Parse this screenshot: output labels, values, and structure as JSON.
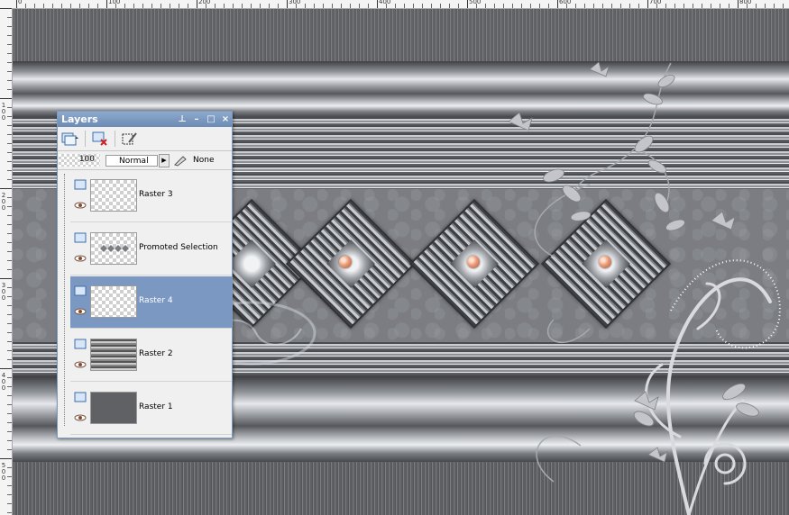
{
  "ruler": {
    "top_labels": [
      "0",
      "100",
      "200",
      "300",
      "400",
      "500",
      "600",
      "700",
      "800"
    ],
    "left_labels": [
      "1\n0\n0",
      "2\n0\n0",
      "3\n0\n0",
      "4\n0\n0",
      "5\n0\n0"
    ]
  },
  "layers_panel": {
    "title": "Layers",
    "pin_icon": "pin-icon",
    "opacity_value": "100",
    "blend_mode": "Normal",
    "mask_value": "None",
    "layers": [
      {
        "name": "Raster 3",
        "selected": false
      },
      {
        "name": "Promoted Selection",
        "selected": false
      },
      {
        "name": "Raster 4",
        "selected": true
      },
      {
        "name": "Raster 2",
        "selected": false
      },
      {
        "name": "Raster 1",
        "selected": false
      }
    ]
  },
  "colors": {
    "panel_title": "#7a97c0",
    "selected_row": "#7b98c3",
    "gem": "#e89a78"
  }
}
